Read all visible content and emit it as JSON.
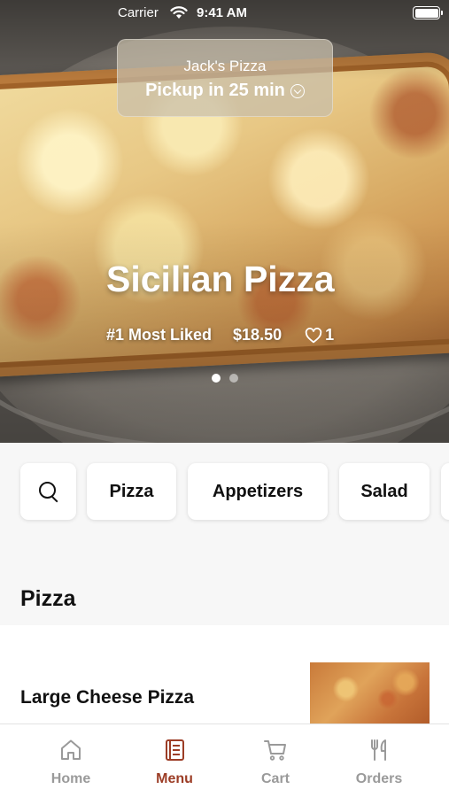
{
  "status_bar": {
    "carrier": "Carrier",
    "time": "9:41 AM"
  },
  "store": {
    "name": "Jack's Pizza",
    "pickup": "Pickup in 25 min"
  },
  "hero": {
    "title": "Sicilian Pizza",
    "tag": "#1 Most Liked",
    "price": "$18.50",
    "likes": "1",
    "slides": 2,
    "active_slide": 1
  },
  "categories": {
    "items": [
      "Pizza",
      "Appetizers",
      "Salad"
    ]
  },
  "section": {
    "title": "Pizza",
    "items": [
      {
        "name": "Large Cheese Pizza"
      }
    ]
  },
  "tabs": [
    {
      "label": "Home",
      "icon": "home-icon",
      "active": false
    },
    {
      "label": "Menu",
      "icon": "menu-book-icon",
      "active": true
    },
    {
      "label": "Cart",
      "icon": "cart-icon",
      "active": false
    },
    {
      "label": "Orders",
      "icon": "fork-knife-icon",
      "active": false
    }
  ],
  "colors": {
    "accent": "#9c3d26",
    "tab_inactive": "#9a9a9a"
  }
}
